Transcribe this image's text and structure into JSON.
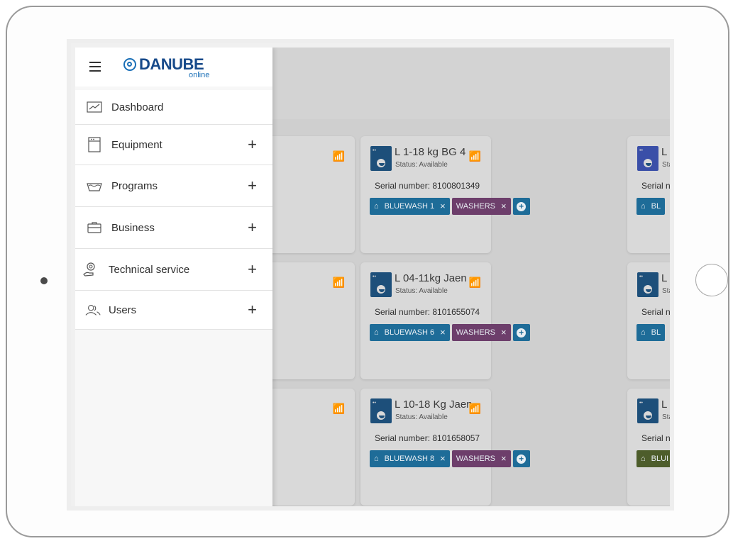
{
  "brand": {
    "name": "DANUBE",
    "sub": "online"
  },
  "nav": [
    {
      "label": "Dashboard",
      "icon": "chart-line-icon",
      "expand": ""
    },
    {
      "label": "Equipment",
      "icon": "washer-icon",
      "expand": "+"
    },
    {
      "label": "Programs",
      "icon": "basin-icon",
      "expand": "+"
    },
    {
      "label": "Business",
      "icon": "briefcase-icon",
      "expand": "+"
    },
    {
      "label": "Technical service",
      "icon": "service-icon",
      "expand": "+"
    },
    {
      "label": "Users",
      "icon": "users-icon",
      "expand": "+"
    }
  ],
  "cards": [
    {
      "title": "L 1-18 kg BG 4",
      "status": "Status: Available",
      "serial": "Serial number: 8100801349",
      "tags": [
        {
          "label": "BLUEWASH 1",
          "x": "×"
        },
        {
          "label": "WASHERS",
          "x": "×"
        }
      ]
    },
    {
      "title": "L 04-11kg Jaen",
      "status": "Status: Available",
      "serial": "Serial number: 8101655074",
      "tags": [
        {
          "label": "BLUEWASH 6",
          "x": "×"
        },
        {
          "label": "WASHERS",
          "x": "×"
        }
      ]
    },
    {
      "title": "L 10-18 Kg Jaen",
      "status": "Status: Available",
      "serial": "Serial number: 8101658057",
      "tags": [
        {
          "label": "BLUEWASH 8",
          "x": "×"
        },
        {
          "label": "WASHERS",
          "x": "×"
        }
      ]
    }
  ],
  "partial": {
    "title_fragment": "L",
    "status_fragment": "Sta",
    "serial_fragment": "Serial n",
    "tag_fragment": "BL",
    "tag_fragment_last": "BLUI",
    "close_x": "×"
  },
  "colors": {
    "accent": "#1e6c98",
    "purple_tag": "#6d3e6b",
    "olive_tag": "#4d5d2b",
    "brand": "#174a8a"
  }
}
